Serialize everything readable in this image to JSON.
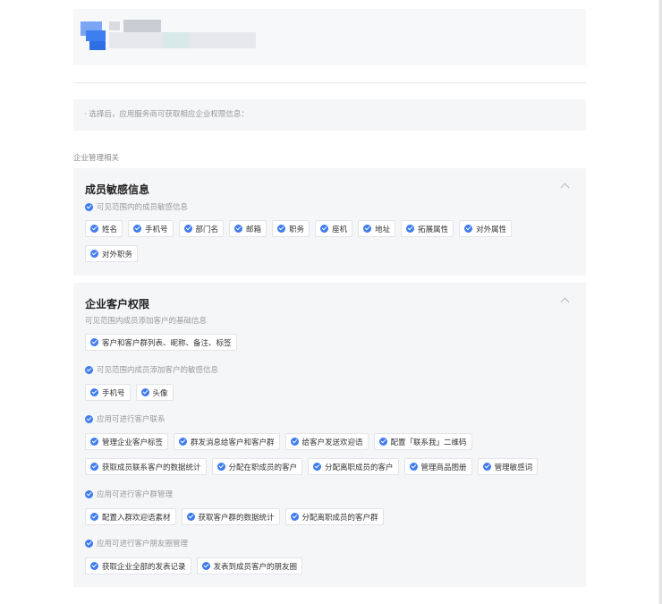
{
  "notice": "· 选择后，应用服务商可获取相应企业权限信息：",
  "group_label": "企业管理相关",
  "cards": {
    "member": {
      "title": "成员敏感信息",
      "sections": [
        {
          "label": "可见范围内的成员敏感信息",
          "tags": [
            "姓名",
            "手机号",
            "部门名",
            "邮箱",
            "职务",
            "座机",
            "地址",
            "拓展属性",
            "对外属性",
            "对外职务"
          ]
        }
      ]
    },
    "customer": {
      "title": "企业客户权限",
      "sections": [
        {
          "label": "可见范围内成员添加客户的基础信息",
          "tags": [
            "客户和客户群列表、昵称、备注、标签"
          ]
        },
        {
          "label": "可见范围内成员添加客户的敏感信息",
          "tags": [
            "手机号",
            "头像"
          ]
        },
        {
          "label": "应用可进行客户联系",
          "tags": [
            "管理企业客户标签",
            "群发消息给客户和客户群",
            "给客户发送欢迎语",
            "配置「联系我」二维码",
            "获取成员联系客户的数据统计",
            "分配在职成员的客户",
            "分配离职成员的客户",
            "管理商品图册",
            "管理敏感词"
          ]
        },
        {
          "label": "应用可进行客户群管理",
          "tags": [
            "配置入群欢迎语素材",
            "获取客户群的数据统计",
            "分配离职成员的客户群"
          ]
        },
        {
          "label": "应用可进行客户朋友圈管理",
          "tags": [
            "获取企业全部的发表记录",
            "发表到成员客户的朋友圈"
          ]
        }
      ]
    }
  },
  "icons": {
    "check": "check-circle-icon",
    "collapse": "chevron-up-icon"
  },
  "colors": {
    "accent": "#3e7cf0",
    "card_bg": "#f5f6f8"
  }
}
